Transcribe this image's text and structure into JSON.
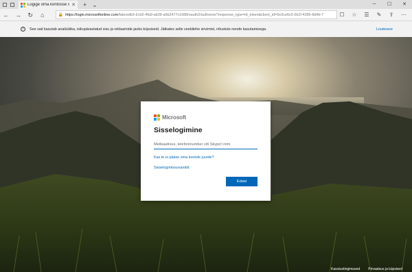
{
  "browser": {
    "tab_title": "Logige oma kontosse si",
    "tab_close": "✕",
    "new_tab": "+",
    "tab_menu": "⌄",
    "url_domain": "https://login.microsoftonline.com",
    "url_path": "/fabcedb3-b1d2-4fa9-ab39-a5b2477c1088/oauth2/authorize?response_type=id_token&client_id=5e3ce6c0-2b1f-4285-8d4b-7"
  },
  "window_controls": {
    "minimize": "─",
    "maximize": "☐",
    "close": "✕"
  },
  "cookie_banner": {
    "text": "See sait kasutab analüütika, isikupärastatud sisu ja reklaamide jaoks küpsiseid. Jätkates selle veebilehe sirvimist, nõustute nende kasutamisega.",
    "more_link": "Lisateave"
  },
  "signin": {
    "brand": "Microsoft",
    "heading": "Sisselogimine",
    "email_placeholder": "Meiliaadress, telefoninumber või Skype'i nimi",
    "cant_access": "Kas te ei pääse oma kontole juurde?",
    "options": "Sisselogimissuvandid",
    "next": "Edasi"
  },
  "footer": {
    "terms": "Kasutustingimused",
    "privacy": "Privaatsus ja küpsised"
  },
  "colors": {
    "accent": "#0067b8",
    "ms_red": "#f25022",
    "ms_green": "#7fba00",
    "ms_blue": "#00a4ef",
    "ms_yellow": "#ffb900"
  }
}
